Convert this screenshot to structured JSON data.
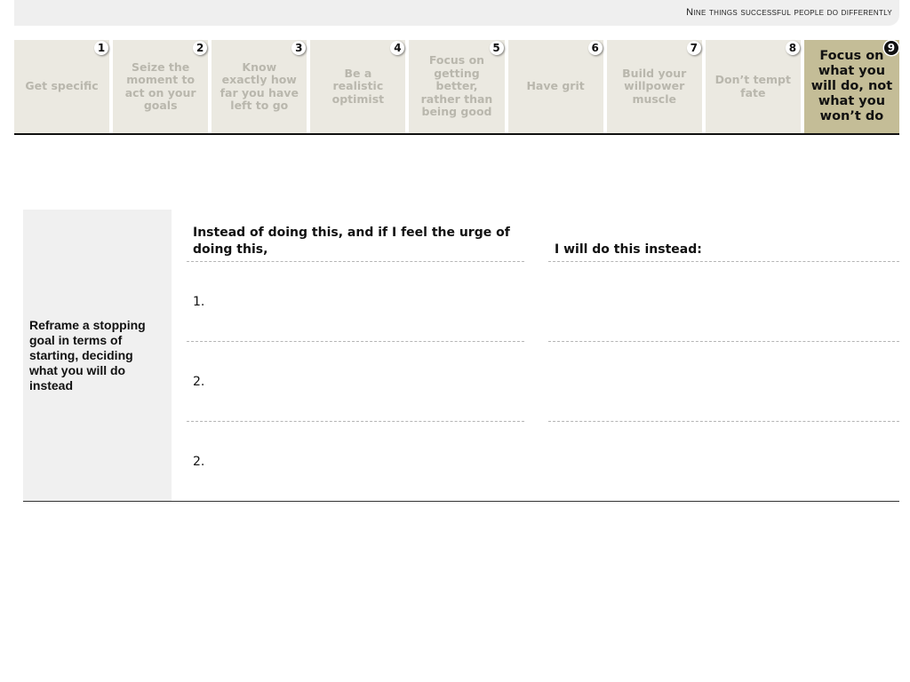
{
  "header": {
    "title": "Nine things successful people do differently"
  },
  "steps": [
    {
      "number": "1",
      "label": "Get specific"
    },
    {
      "number": "2",
      "label": "Seize the moment to act on your goals"
    },
    {
      "number": "3",
      "label": "Know exactly how far you have left to go"
    },
    {
      "number": "4",
      "label": "Be a realistic optimist"
    },
    {
      "number": "5",
      "label": "Focus on getting better, rather than being good"
    },
    {
      "number": "6",
      "label": "Have grit"
    },
    {
      "number": "7",
      "label": "Build your willpower muscle"
    },
    {
      "number": "8",
      "label": "Don’t tempt fate"
    },
    {
      "number": "9",
      "label": "Focus on what you will do, not what you won’t do",
      "active": true
    }
  ],
  "colors": {
    "active_step": "#c4bd97",
    "inactive_step": "#ebe9e1",
    "side_panel": "#f0f0f0"
  },
  "worksheet": {
    "instruction": "Reframe a stopping goal in terms of starting, deciding what you will do instead",
    "column_left_heading": "Instead of doing this, and if I feel the urge of doing this,",
    "column_right_heading": "I will do this instead:",
    "rows": [
      "1.",
      "2.",
      "2."
    ]
  }
}
